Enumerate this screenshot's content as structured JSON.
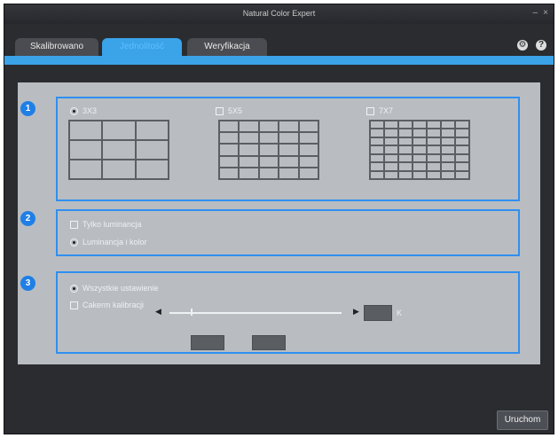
{
  "window": {
    "title": "Natural Color Expert",
    "minimize": "–",
    "close": "×"
  },
  "tabs": [
    {
      "label": "Skalibrowano",
      "active": false
    },
    {
      "label": "Jednolitość",
      "active": true
    },
    {
      "label": "Weryfikacja",
      "active": false
    }
  ],
  "top_icons": [
    {
      "name": "gear-icon",
      "glyph": "⚙"
    },
    {
      "name": "help-icon",
      "glyph": "?"
    }
  ],
  "sections": {
    "s1": {
      "badge": "1",
      "options": [
        {
          "label": "3X3",
          "selected": true,
          "rows": 3,
          "cols": 3
        },
        {
          "label": "5X5",
          "selected": false,
          "rows": 5,
          "cols": 5
        },
        {
          "label": "7X7",
          "selected": false,
          "rows": 7,
          "cols": 7
        }
      ]
    },
    "s2": {
      "badge": "2",
      "options": [
        {
          "label": "Tylko luminancja",
          "selected": false
        },
        {
          "label": "Luminancja i kolor",
          "selected": true
        }
      ]
    },
    "s3": {
      "badge": "3",
      "options": [
        {
          "label": "Wszystkie ustawienie",
          "selected": true
        },
        {
          "label": "Cakerm kalibracji",
          "selected": false
        }
      ],
      "slider_unit": "K",
      "left_arrow": "◀",
      "right_arrow": "▶"
    }
  },
  "colors": {
    "accent": "#3ba3e8",
    "badge": "#1f7fe6",
    "box_border": "#2f8ff0",
    "panel": "#b9bdc2",
    "window": "#2a2c30"
  },
  "footer": {
    "run_label": "Uruchom"
  }
}
